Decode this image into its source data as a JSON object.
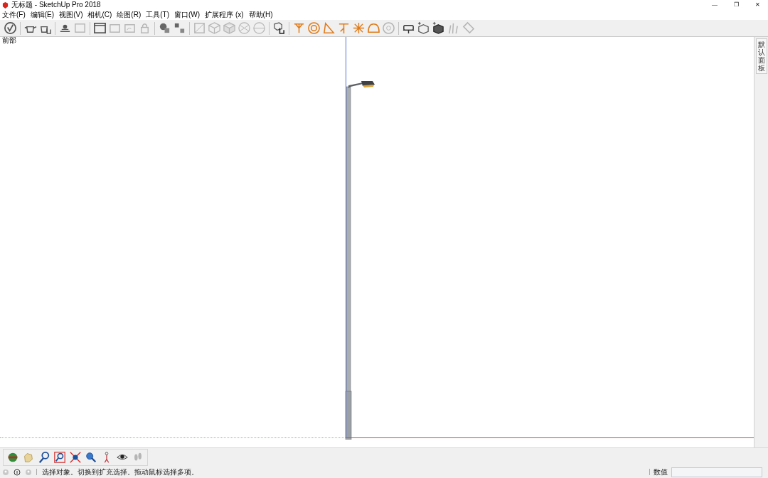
{
  "window": {
    "title": "无标题 - SketchUp Pro 2018",
    "controls": [
      "—",
      "❐",
      "✕"
    ]
  },
  "menu": [
    "文件(F)",
    "编辑(E)",
    "视图(V)",
    "相机(C)",
    "绘图(R)",
    "工具(T)",
    "窗口(W)",
    "扩展程序 (x)",
    "帮助(H)"
  ],
  "viewport": {
    "scene_label": "前部"
  },
  "tray": {
    "tab": "默认面板"
  },
  "status_bar": {
    "prompt": "选择对象。切换到扩充选择。拖动鼠标选择多项。",
    "measurements_label": "数值"
  }
}
